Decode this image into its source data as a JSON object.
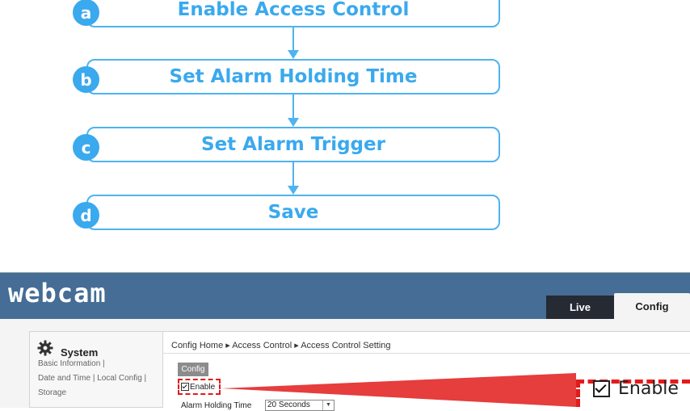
{
  "flow": {
    "steps": [
      {
        "badge": "a",
        "label": "Enable Access Control"
      },
      {
        "badge": "b",
        "label": "Set Alarm Holding Time"
      },
      {
        "badge": "c",
        "label": "Set Alarm Trigger"
      },
      {
        "badge": "d",
        "label": "Save"
      }
    ]
  },
  "app": {
    "logo": "webcam",
    "tabs": {
      "live": "Live",
      "config": "Config"
    },
    "sidebar": {
      "title": "System",
      "title_icon": "gear-icon",
      "links": [
        "Basic Information |",
        "Date and Time | Local Config |",
        "Storage"
      ]
    },
    "breadcrumb": "Config Home ▸ Access Control ▸ Access Control Setting",
    "config_tab": "Config",
    "enable_label": "Enable",
    "enable_checked": true,
    "alarm_holding_time_label": "Alarm Holding Time",
    "alarm_holding_time_value": "20 Seconds",
    "callout_label": "Enable",
    "highlight_color": "#e21b1b",
    "accent_color": "#3aa9ee"
  }
}
